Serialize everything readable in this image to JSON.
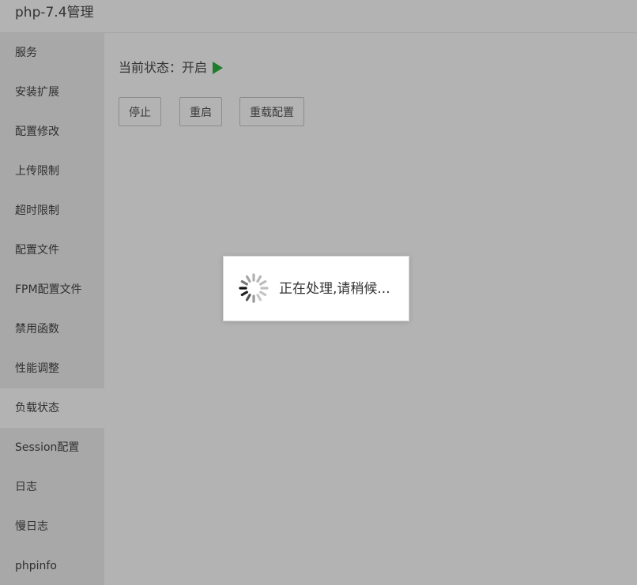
{
  "window": {
    "title": "php-7.4管理"
  },
  "sidebar": {
    "items": [
      {
        "label": "服务"
      },
      {
        "label": "安装扩展"
      },
      {
        "label": "配置修改"
      },
      {
        "label": "上传限制"
      },
      {
        "label": "超时限制"
      },
      {
        "label": "配置文件"
      },
      {
        "label": "FPM配置文件"
      },
      {
        "label": "禁用函数"
      },
      {
        "label": "性能调整"
      },
      {
        "label": "负载状态",
        "active": true
      },
      {
        "label": "Session配置"
      },
      {
        "label": "日志"
      },
      {
        "label": "慢日志"
      },
      {
        "label": "phpinfo"
      }
    ]
  },
  "main": {
    "status_text": "当前状态：开启",
    "status_icon": "play-icon",
    "status_color": "#1e7d2a",
    "buttons": {
      "stop": "停止",
      "restart": "重启",
      "reload": "重载配置"
    }
  },
  "loading": {
    "text": "正在处理,请稍候...",
    "icon": "spinner-icon"
  }
}
